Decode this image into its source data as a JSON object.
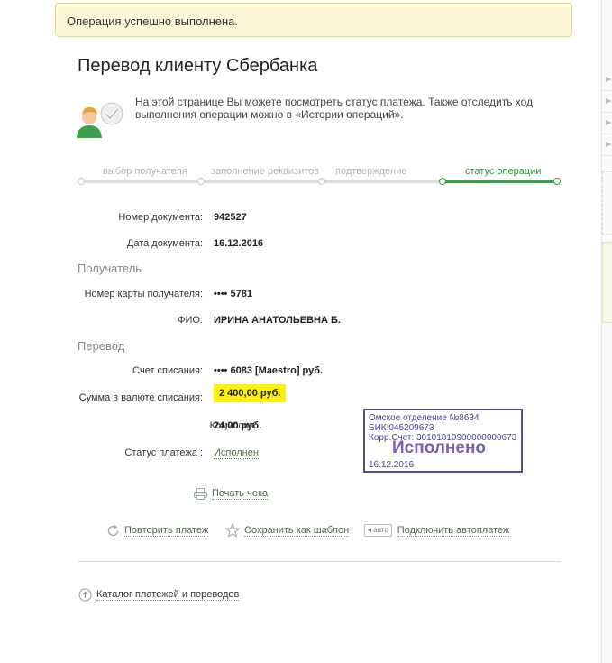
{
  "banner": {
    "text": "Операция успешно выполнена."
  },
  "page": {
    "title": "Перевод клиенту Сбербанка"
  },
  "intro": {
    "text": "На этой странице Вы можете посмотреть статус платежа. Также отследить ход выполнения операции можно в «Истории операций»."
  },
  "steps": [
    {
      "label": "выбор получателя"
    },
    {
      "label": "заполнение реквизитов"
    },
    {
      "label": "подтверждение"
    },
    {
      "label": "статус операции",
      "active": true
    }
  ],
  "document": {
    "number_label": "Номер документа:",
    "number_value": "942527",
    "date_label": "Дата документа:",
    "date_value": "16.12.2016"
  },
  "recipient": {
    "section": "Получатель",
    "card_label": "Номер карты получателя:",
    "card_value": "•••• 5781",
    "fio_label": "ФИО:",
    "fio_value": "ИРИНА АНАТОЛЬЕВНА Б."
  },
  "transfer": {
    "section": "Перевод",
    "account_label": "Счет списания:",
    "account_value": "•••• 6083  [Maestro]  руб.",
    "amount_label": "Сумма в валюте списания:",
    "amount_value": "2 400,00  руб.",
    "fee_label": "Комиссия:",
    "fee_value": "24,00 руб.",
    "status_label": "Статус платежа :",
    "status_value": "Исполнен"
  },
  "stamp": {
    "line1": "Омское отделение №8634",
    "line2": "БИК:045209673",
    "line3": "Корр.Счет: 30101810900000000673",
    "status": "Исполнено",
    "date": "16.12.2016"
  },
  "actions": {
    "print": "Печать чека",
    "repeat": "Повторить платеж",
    "save_template": "Сохранить как шаблон",
    "auto_badge": "авто",
    "autopay": "Подключить автоплатеж"
  },
  "footer": {
    "catalog": "Каталог платежей и переводов"
  },
  "colors": {
    "accent_green": "#37a148",
    "highlight_yellow": "#fff200",
    "stamp_purple": "#5a4a8a"
  }
}
